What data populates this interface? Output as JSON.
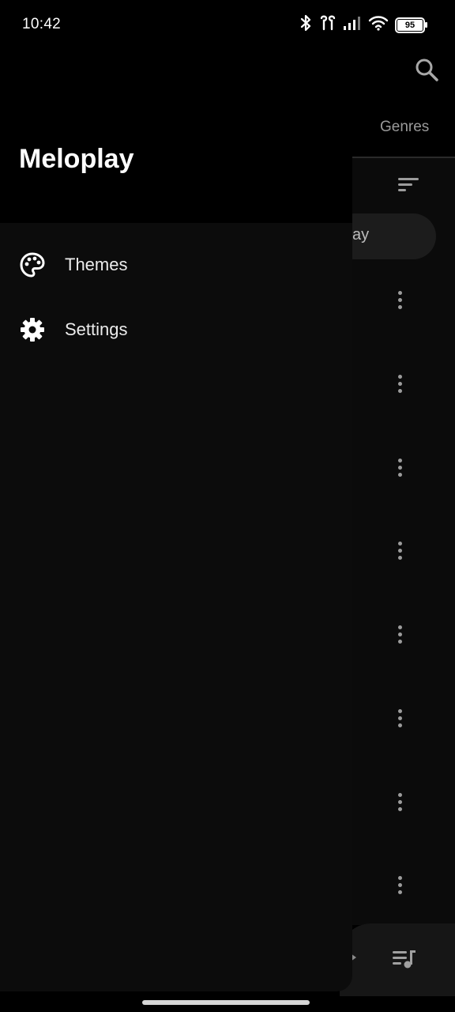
{
  "status_bar": {
    "time": "10:42",
    "battery": "95",
    "icons": [
      "bluetooth-icon",
      "earbuds-icon",
      "signal-icon",
      "wifi-icon",
      "battery-icon"
    ]
  },
  "background": {
    "tab_genres": "Genres",
    "play_button_fragment": "ay",
    "icons": [
      "search-icon",
      "sort-icon",
      "more-vert-icon",
      "queue-music-icon"
    ]
  },
  "drawer": {
    "title": "Meloplay",
    "logo_colors": [
      "#ff6fa5",
      "#c341a6",
      "#7b4dc8"
    ],
    "items": [
      {
        "label": "Themes",
        "icon": "palette-icon"
      },
      {
        "label": "Settings",
        "icon": "gear-icon"
      }
    ]
  },
  "colors": {
    "drawer_bg": "#0c0c0c",
    "header_bg": "#000000",
    "text": "#ffffff",
    "muted_text": "#9a9a9a"
  }
}
